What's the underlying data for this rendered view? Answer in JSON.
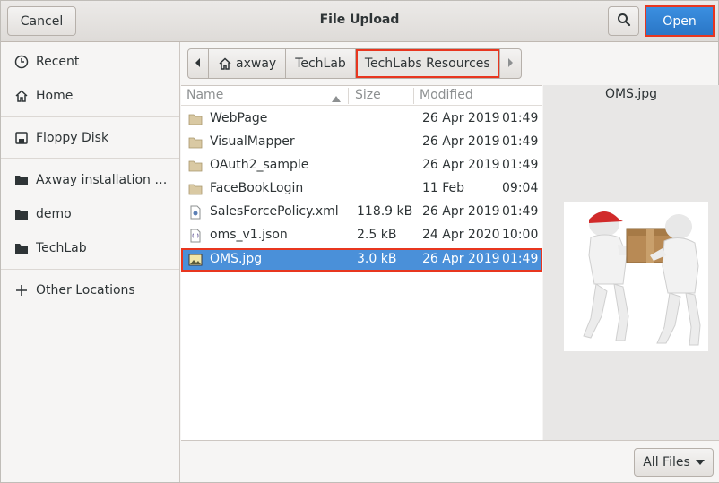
{
  "header": {
    "cancel_label": "Cancel",
    "title": "File Upload",
    "open_label": "Open",
    "accent_color": "#4a90d9",
    "highlight_color": "#e8361f"
  },
  "sidebar": {
    "items": [
      {
        "label": "Recent",
        "icon": "clock-icon"
      },
      {
        "label": "Home",
        "icon": "home-icon"
      },
      {
        "label": "Floppy Disk",
        "icon": "floppy-icon"
      },
      {
        "label": "Axway installation d...",
        "icon": "folder-icon"
      },
      {
        "label": "demo",
        "icon": "folder-icon"
      },
      {
        "label": "TechLab",
        "icon": "folder-icon"
      },
      {
        "label": "Other Locations",
        "icon": "plus-icon"
      }
    ]
  },
  "pathbar": {
    "segments": [
      "axway",
      "TechLab",
      "TechLabs Resources"
    ]
  },
  "filelist": {
    "columns": {
      "name": "Name",
      "size": "Size",
      "modified": "Modified"
    },
    "rows": [
      {
        "name": "WebPage",
        "size": "",
        "date": "26 Apr 2019",
        "time": "01:49",
        "type": "folder"
      },
      {
        "name": "VisualMapper",
        "size": "",
        "date": "26 Apr 2019",
        "time": "01:49",
        "type": "folder"
      },
      {
        "name": "OAuth2_sample",
        "size": "",
        "date": "26 Apr 2019",
        "time": "01:49",
        "type": "folder"
      },
      {
        "name": "FaceBookLogin",
        "size": "",
        "date": "11 Feb",
        "time": "09:04",
        "type": "folder"
      },
      {
        "name": "SalesForcePolicy.xml",
        "size": "118.9 kB",
        "date": "26 Apr 2019",
        "time": "01:49",
        "type": "xml"
      },
      {
        "name": "oms_v1.json",
        "size": "2.5 kB",
        "date": "24 Apr 2020",
        "time": "10:00",
        "type": "json"
      },
      {
        "name": "OMS.jpg",
        "size": "3.0 kB",
        "date": "26 Apr 2019",
        "time": "01:49",
        "type": "image",
        "selected": true
      }
    ]
  },
  "preview": {
    "title": "OMS.jpg"
  },
  "footer": {
    "filter_label": "All Files"
  }
}
